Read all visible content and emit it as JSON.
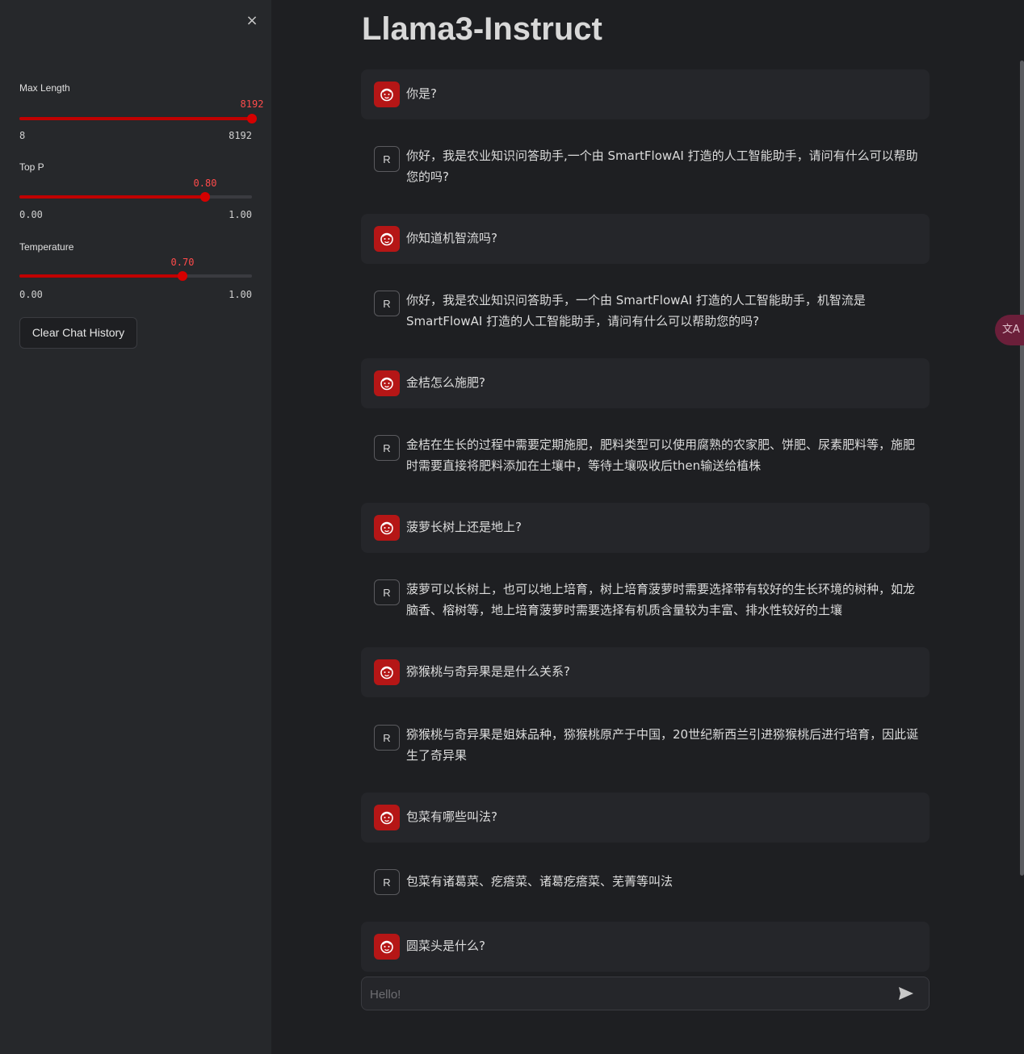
{
  "sidebar": {
    "close_icon": "×",
    "sliders": {
      "max_length": {
        "label": "Max Length",
        "value_text": "8192",
        "min_text": "8",
        "max_text": "8192",
        "fraction": 1.0
      },
      "top_p": {
        "label": "Top P",
        "value_text": "0.80",
        "min_text": "0.00",
        "max_text": "1.00",
        "fraction": 0.8
      },
      "temperature": {
        "label": "Temperature",
        "value_text": "0.70",
        "min_text": "0.00",
        "max_text": "1.00",
        "fraction": 0.7
      }
    },
    "clear_button": "Clear Chat History"
  },
  "main": {
    "title": "Llama3-Instruct",
    "assistant_avatar_letter": "R",
    "messages": [
      {
        "role": "user",
        "text": "你是?"
      },
      {
        "role": "assistant",
        "text": "你好，我是农业知识问答助手,一个由 SmartFlowAI 打造的人工智能助手，请问有什么可以帮助您的吗?"
      },
      {
        "role": "user",
        "text": "你知道机智流吗?"
      },
      {
        "role": "assistant",
        "text": "你好，我是农业知识问答助手，一个由 SmartFlowAI 打造的人工智能助手，机智流是 SmartFlowAI 打造的人工智能助手，请问有什么可以帮助您的吗?"
      },
      {
        "role": "user",
        "text": "金桔怎么施肥?"
      },
      {
        "role": "assistant",
        "text": "金桔在生长的过程中需要定期施肥，肥料类型可以使用腐熟的农家肥、饼肥、尿素肥料等，施肥时需要直接将肥料添加在土壤中，等待土壤吸收后then输送给植株"
      },
      {
        "role": "user",
        "text": "菠萝长树上还是地上?"
      },
      {
        "role": "assistant",
        "text": "菠萝可以长树上，也可以地上培育，树上培育菠萝时需要选择带有较好的生长环境的树种，如龙脑香、榕树等，地上培育菠萝时需要选择有机质含量较为丰富、排水性较好的土壤"
      },
      {
        "role": "user",
        "text": "猕猴桃与奇异果是是什么关系?"
      },
      {
        "role": "assistant",
        "text": "猕猴桃与奇异果是姐妹品种，猕猴桃原产于中国，20世纪新西兰引进猕猴桃后进行培育，因此诞生了奇异果"
      },
      {
        "role": "user",
        "text": "包菜有哪些叫法?"
      },
      {
        "role": "assistant",
        "text": "包菜有诸葛菜、疙瘩菜、诸葛疙瘩菜、芜菁等叫法"
      },
      {
        "role": "user",
        "text": "圆菜头是什么?"
      }
    ],
    "input": {
      "placeholder": "Hello!",
      "value": ""
    }
  },
  "translate_fab_text": "文A",
  "colors": {
    "accent": "#ff4b4b",
    "slider_fill": "#c00000",
    "user_avatar": "#b51616"
  }
}
